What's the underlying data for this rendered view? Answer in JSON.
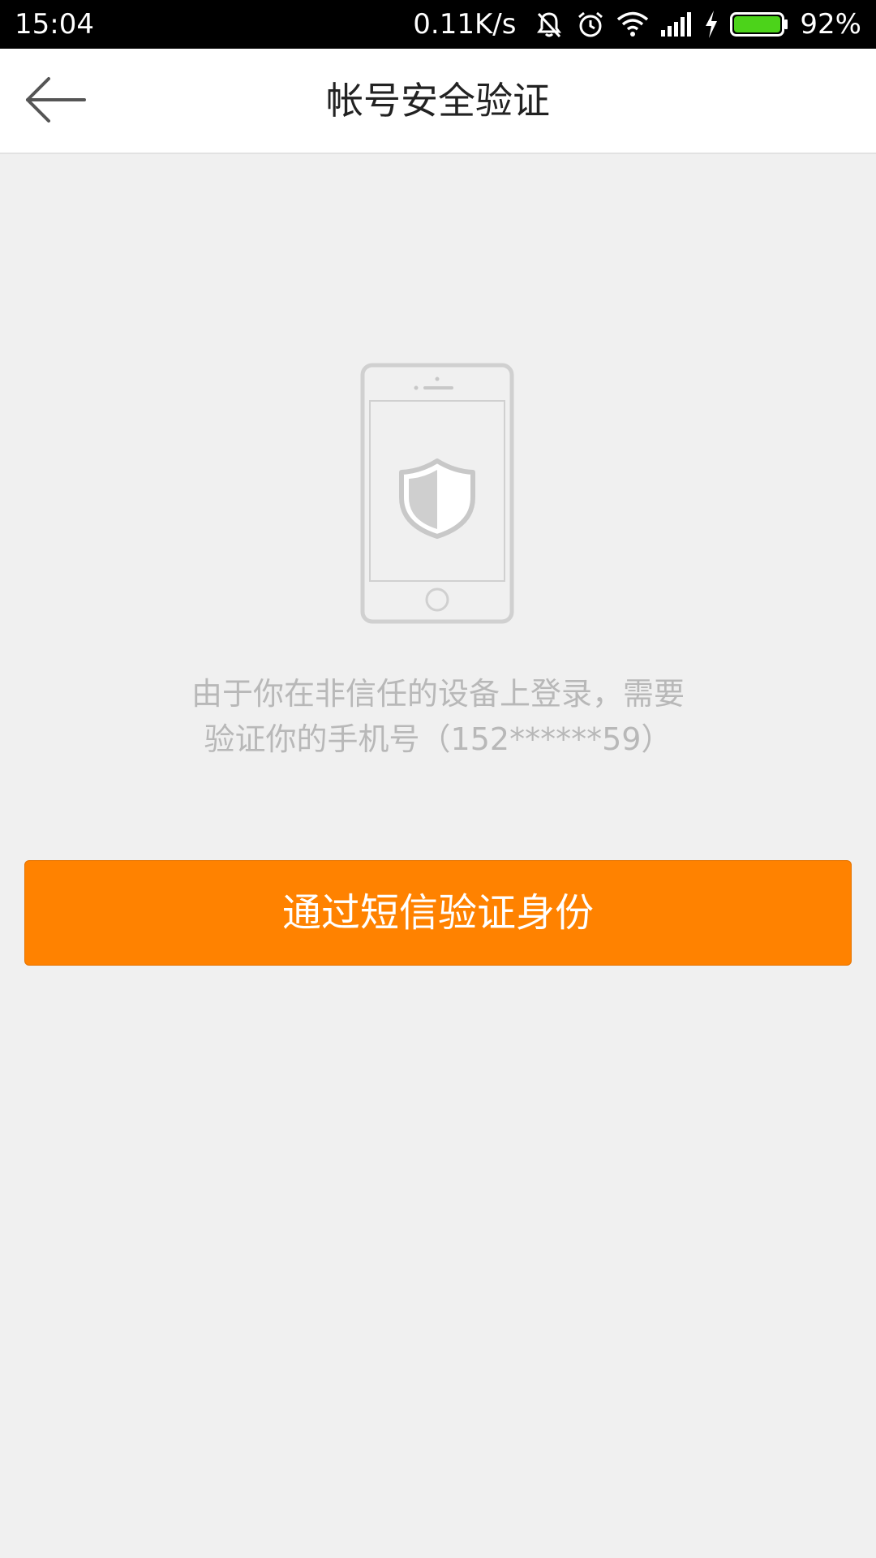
{
  "status_bar": {
    "time": "15:04",
    "network_speed": "0.11K/s",
    "battery_percent": "92%",
    "battery_level": 0.92,
    "icons": [
      "mute-icon",
      "alarm-icon",
      "wifi-icon",
      "signal-icon",
      "charging-icon",
      "battery-icon"
    ]
  },
  "header": {
    "title": "帐号安全验证",
    "back_icon": "back-arrow-icon"
  },
  "illustration": {
    "icon": "phone-shield-icon"
  },
  "message": {
    "line1": "由于你在非信任的设备上登录，需要",
    "line2": "验证你的手机号（152******59）"
  },
  "action": {
    "verify_button_label": "通过短信验证身份"
  },
  "colors": {
    "primary": "#ff8200",
    "status_bar_bg": "#000000",
    "page_bg": "#f0f0f0",
    "message_text": "#b8b8b8",
    "battery_fill": "#4cd31a"
  }
}
